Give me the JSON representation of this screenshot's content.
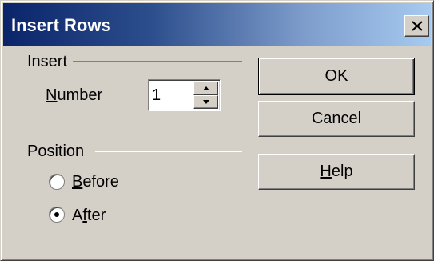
{
  "window": {
    "title": "Insert Rows",
    "close_icon": "close-icon"
  },
  "insert_group": {
    "label": "Insert",
    "number_label_mnemonic": "N",
    "number_label_rest": "umber",
    "number_value": "1"
  },
  "position_group": {
    "label": "Position",
    "before": {
      "mnemonic": "B",
      "rest": "efore",
      "selected": false
    },
    "after": {
      "prefix": "A",
      "mnemonic": "f",
      "rest": "ter",
      "selected": true
    }
  },
  "buttons": {
    "ok": "OK",
    "cancel": "Cancel",
    "help_mnemonic": "H",
    "help_rest": "elp"
  }
}
